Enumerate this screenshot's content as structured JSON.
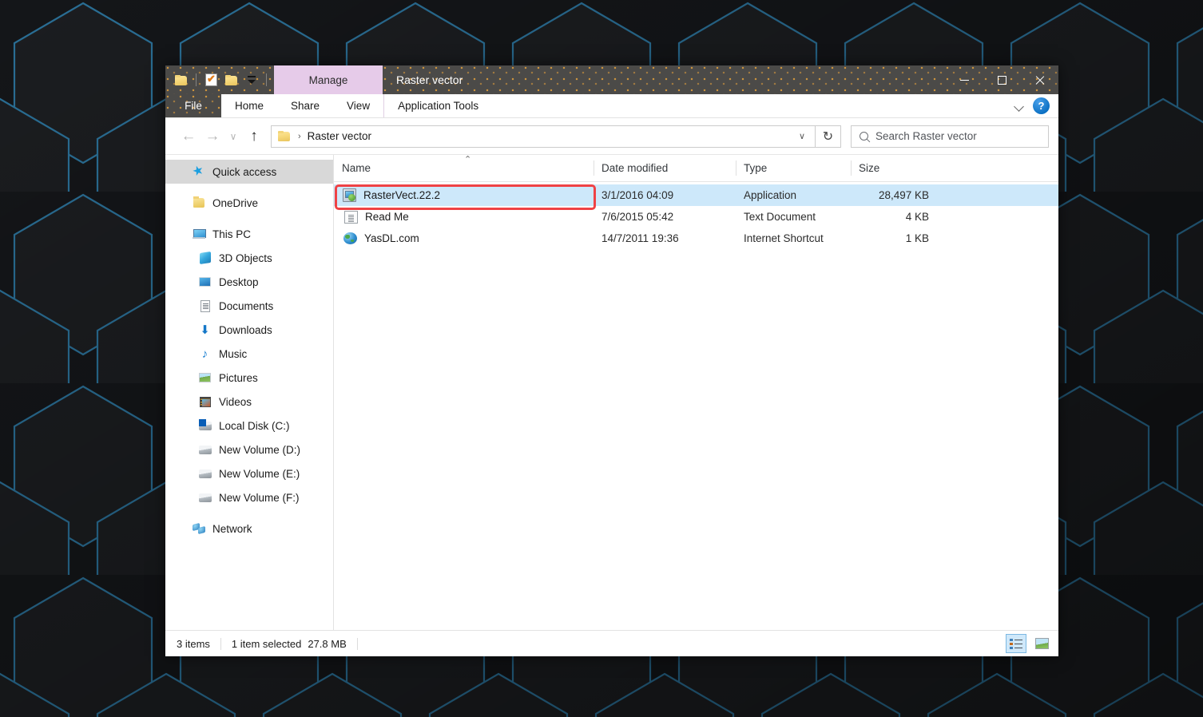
{
  "window": {
    "title": "Raster vector",
    "quick_access_toolbar": [
      {
        "name": "folder-icon",
        "label": "Folder"
      },
      {
        "name": "properties-icon",
        "label": "Properties"
      },
      {
        "name": "new-folder-icon",
        "label": "New folder"
      },
      {
        "name": "customize-caret-icon",
        "label": "Customize Quick Access Toolbar"
      }
    ],
    "manage_tab_label": "Manage",
    "manage_tab_color": "#e6cbe9",
    "controls": {
      "minimize": "Minimize",
      "maximize": "Maximize",
      "close": "Close"
    }
  },
  "ribbon": {
    "tabs": [
      {
        "label": "File",
        "active": true
      },
      {
        "label": "Home",
        "active": false
      },
      {
        "label": "Share",
        "active": false
      },
      {
        "label": "View",
        "active": false
      },
      {
        "label": "Application Tools",
        "active": false,
        "contextual": true
      }
    ],
    "collapse_label": "∨",
    "help_label": "?"
  },
  "addressbar": {
    "back": "←",
    "forward": "→",
    "recent": "∨",
    "up": "↑",
    "crumb_separator": "›",
    "path": "Raster vector",
    "dropdown_caret": "∨",
    "refresh": "↻",
    "search_placeholder": "Search Raster vector"
  },
  "sidebar": {
    "items": [
      {
        "label": "Quick access",
        "icon": "star-icon",
        "level": 0,
        "selected": true
      },
      {
        "label": "OneDrive",
        "icon": "onedrive-folder-icon",
        "level": 0,
        "selected": false,
        "gap_before": true
      },
      {
        "label": "This PC",
        "icon": "this-pc-icon",
        "level": 0,
        "selected": false,
        "gap_before": true
      },
      {
        "label": "3D Objects",
        "icon": "3d-objects-icon",
        "level": 1,
        "selected": false
      },
      {
        "label": "Desktop",
        "icon": "desktop-icon",
        "level": 1,
        "selected": false
      },
      {
        "label": "Documents",
        "icon": "documents-icon",
        "level": 1,
        "selected": false
      },
      {
        "label": "Downloads",
        "icon": "downloads-icon",
        "level": 1,
        "selected": false
      },
      {
        "label": "Music",
        "icon": "music-icon",
        "level": 1,
        "selected": false
      },
      {
        "label": "Pictures",
        "icon": "pictures-icon",
        "level": 1,
        "selected": false
      },
      {
        "label": "Videos",
        "icon": "videos-icon",
        "level": 1,
        "selected": false
      },
      {
        "label": "Local Disk (C:)",
        "icon": "local-disk-icon",
        "level": 1,
        "selected": false
      },
      {
        "label": "New Volume (D:)",
        "icon": "drive-icon",
        "level": 1,
        "selected": false
      },
      {
        "label": "New Volume (E:)",
        "icon": "drive-icon",
        "level": 1,
        "selected": false
      },
      {
        "label": "New Volume (F:)",
        "icon": "drive-icon",
        "level": 1,
        "selected": false
      },
      {
        "label": "Network",
        "icon": "network-icon",
        "level": 0,
        "selected": false,
        "gap_before": true
      }
    ]
  },
  "filelist": {
    "columns": [
      {
        "key": "name",
        "label": "Name",
        "sorted": "asc"
      },
      {
        "key": "date",
        "label": "Date modified"
      },
      {
        "key": "type",
        "label": "Type"
      },
      {
        "key": "size",
        "label": "Size"
      }
    ],
    "sort_caret": "⌃",
    "rows": [
      {
        "name": "RasterVect.22.2",
        "date": "3/1/2016 04:09",
        "type": "Application",
        "size": "28,497 KB",
        "icon": "installer-icon",
        "selected": true,
        "annotated": true
      },
      {
        "name": "Read Me",
        "date": "7/6/2015 05:42",
        "type": "Text Document",
        "size": "4 KB",
        "icon": "text-document-icon",
        "selected": false,
        "annotated": false
      },
      {
        "name": "YasDL.com",
        "date": "14/7/2011 19:36",
        "type": "Internet Shortcut",
        "size": "1 KB",
        "icon": "internet-shortcut-icon",
        "selected": false,
        "annotated": false
      }
    ]
  },
  "statusbar": {
    "item_count": "3 items",
    "selection_info": "1 item selected",
    "selection_size": "27.8 MB",
    "views": [
      {
        "name": "details-view-button",
        "label": "Details view",
        "active": true
      },
      {
        "name": "large-icons-view-button",
        "label": "Large icons view",
        "active": false
      }
    ]
  },
  "annotation": {
    "color": "#ef4245"
  }
}
